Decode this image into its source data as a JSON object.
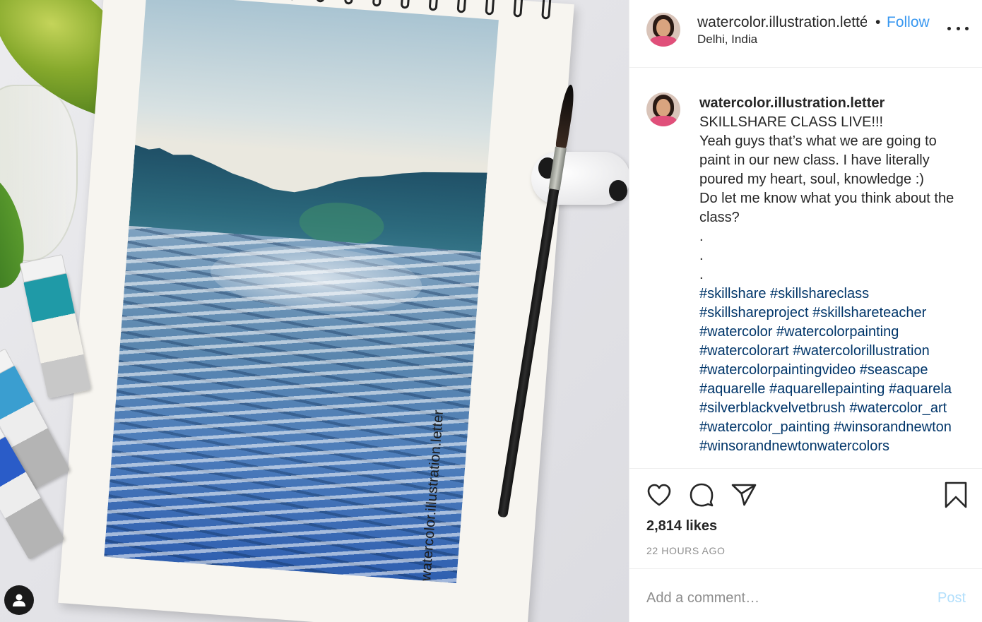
{
  "photo": {
    "watermark": "watercolor.illustration.letter",
    "profile_badge_icon": "user-silhouette-icon"
  },
  "header": {
    "username": "watercolor.illustration.letté",
    "separator": "•",
    "follow_label": "Follow",
    "location": "Delhi, India",
    "more_icon": "more-horizontal-icon"
  },
  "caption": {
    "username": "watercolor.illustration.letter",
    "lines": [
      "SKILLSHARE CLASS LIVE!!!",
      "Yeah guys that’s what we are going to paint in our new class. I have literally poured my heart, soul, knowledge :)",
      "Do let me know what you think about the class?",
      ".",
      ".",
      "."
    ],
    "hashtags": "#skillshare #skillshareclass #skillshareproject #skillshareteacher #watercolor #watercolorpainting #watercolorart #watercolorillustration #watercolorpaintingvideo #seascape #aquarelle #aquarellepainting #aquarela #silverblackvelvetbrush #watercolor_art #watercolor_painting #winsorandnewton #winsorandnewtonwatercolors"
  },
  "actions": {
    "icons": [
      "heart-icon",
      "comment-icon",
      "share-icon",
      "bookmark-icon"
    ],
    "likes": "2,814 likes",
    "timestamp": "22 HOURS AGO"
  },
  "comment": {
    "placeholder": "Add a comment…",
    "post_label": "Post"
  },
  "colors": {
    "link_blue": "#3897f0",
    "hashtag": "#003569",
    "post_disabled": "#b2dffc",
    "muted": "#8e8e8e"
  }
}
